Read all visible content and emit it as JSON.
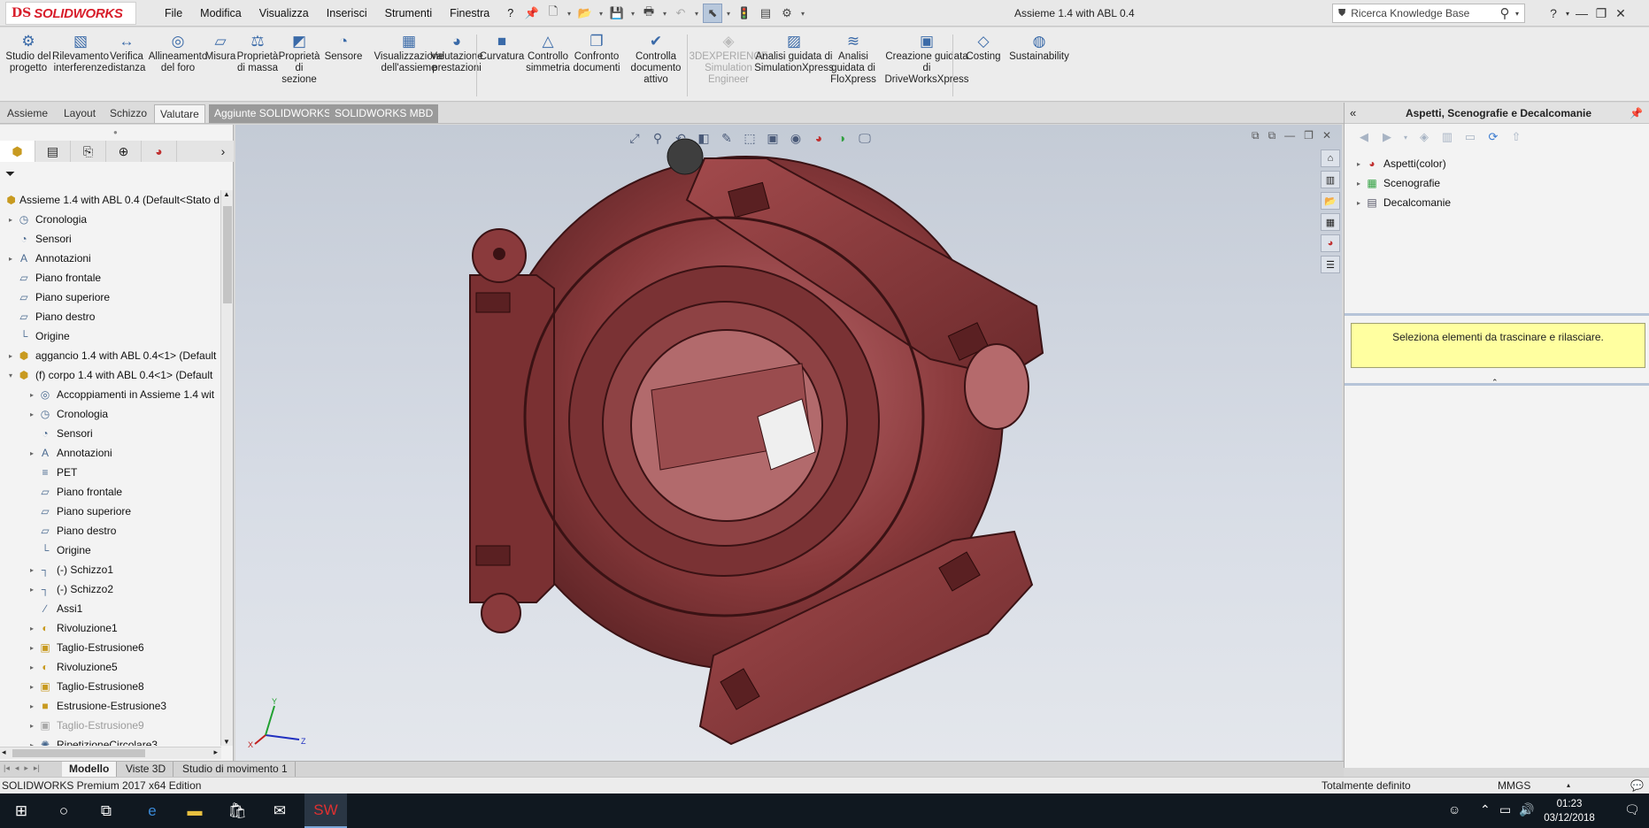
{
  "app": {
    "brand": "SOLIDWORKS",
    "brand_prefix": "DS",
    "document_title": "Assieme 1.4 with ABL 0.4",
    "search_placeholder": "Ricerca Knowledge Base",
    "help": "?"
  },
  "menu": [
    "File",
    "Modifica",
    "Visualizza",
    "Inserisci",
    "Strumenti",
    "Finestra",
    "?"
  ],
  "commands": [
    {
      "id": "studio-progetto",
      "label": "Studio del progetto",
      "icon": "design-study-icon",
      "glyph": "⚙",
      "disabled": false
    },
    {
      "id": "rilevamento-interferenze",
      "label": "Rilevamento interferenze",
      "icon": "interference-icon",
      "glyph": "▧",
      "disabled": false
    },
    {
      "id": "verifica-distanza",
      "label": "Verifica distanza",
      "icon": "clearance-icon",
      "glyph": "↔",
      "disabled": false
    },
    {
      "id": "allineamento-foro",
      "label": "Allineamento del foro",
      "icon": "hole-alignment-icon",
      "glyph": "◎",
      "disabled": false
    },
    {
      "id": "misura",
      "label": "Misura",
      "icon": "measure-icon",
      "glyph": "▱",
      "disabled": false
    },
    {
      "id": "proprieta-massa",
      "label": "Proprietà di massa",
      "icon": "mass-properties-icon",
      "glyph": "⚖",
      "disabled": false
    },
    {
      "id": "proprieta-sezione",
      "label": "Proprietà di sezione",
      "icon": "section-properties-icon",
      "glyph": "◩",
      "disabled": false
    },
    {
      "id": "sensore",
      "label": "Sensore",
      "icon": "sensor-icon",
      "glyph": "◔",
      "disabled": false
    },
    {
      "id": "visualizzazione-assieme",
      "label": "Visualizzazione dell'assieme",
      "icon": "assembly-visualization-icon",
      "glyph": "▦",
      "disabled": false
    },
    {
      "id": "valutazione-prestazioni",
      "label": "Valutazione prestazioni",
      "icon": "performance-icon",
      "glyph": "◕",
      "disabled": false
    },
    {
      "id": "curvatura",
      "label": "Curvatura",
      "icon": "curvature-icon",
      "glyph": "■",
      "disabled": false
    },
    {
      "id": "controllo-simmetria",
      "label": "Controllo simmetria",
      "icon": "symmetry-icon",
      "glyph": "△",
      "disabled": false
    },
    {
      "id": "confronto-documenti",
      "label": "Confronto documenti",
      "icon": "compare-documents-icon",
      "glyph": "❐",
      "disabled": false
    },
    {
      "id": "controlla-documento",
      "label": "Controlla documento attivo",
      "icon": "check-document-icon",
      "glyph": "✔",
      "disabled": false
    },
    {
      "id": "3dexperience",
      "label": "3DEXPERIENCE Simulation Engineer",
      "icon": "3dexperience-icon",
      "glyph": "◈",
      "disabled": true
    },
    {
      "id": "simulationxpress",
      "label": "Analisi guidata di SimulationXpress",
      "icon": "simulationxpress-icon",
      "glyph": "▨",
      "disabled": false
    },
    {
      "id": "floxpress",
      "label": "Analisi guidata di FloXpress",
      "icon": "floxpress-icon",
      "glyph": "≋",
      "disabled": false
    },
    {
      "id": "driveworksxpress",
      "label": "Creazione guidata di DriveWorksXpress",
      "icon": "driveworks-icon",
      "glyph": "▣",
      "disabled": false
    },
    {
      "id": "costing",
      "label": "Costing",
      "icon": "costing-icon",
      "glyph": "◇",
      "disabled": false
    },
    {
      "id": "sustainability",
      "label": "Sustainability",
      "icon": "sustainability-icon",
      "glyph": "◍",
      "disabled": false
    }
  ],
  "tabs": [
    "Assieme",
    "Layout",
    "Schizzo",
    "Valutare",
    "Aggiunte SOLIDWORKS",
    "SOLIDWORKS MBD"
  ],
  "active_tab": "Valutare",
  "tree": [
    {
      "label": "Assieme 1.4 with ABL 0.4  (Default<Stato d",
      "level": 0,
      "expander": "",
      "icon": "assembly-icon",
      "glyph": "⬢"
    },
    {
      "label": "Cronologia",
      "level": 1,
      "expander": "▸",
      "icon": "history-icon",
      "glyph": "◷"
    },
    {
      "label": "Sensori",
      "level": 1,
      "expander": "",
      "icon": "sensor-icon",
      "glyph": "◔"
    },
    {
      "label": "Annotazioni",
      "level": 1,
      "expander": "▸",
      "icon": "annotations-icon",
      "glyph": "A"
    },
    {
      "label": "Piano frontale",
      "level": 1,
      "expander": "",
      "icon": "plane-icon",
      "glyph": "▱"
    },
    {
      "label": "Piano superiore",
      "level": 1,
      "expander": "",
      "icon": "plane-icon",
      "glyph": "▱"
    },
    {
      "label": "Piano destro",
      "level": 1,
      "expander": "",
      "icon": "plane-icon",
      "glyph": "▱"
    },
    {
      "label": "Origine",
      "level": 1,
      "expander": "",
      "icon": "origin-icon",
      "glyph": "└"
    },
    {
      "label": "aggancio 1.4 with ABL 0.4<1> (Default",
      "level": 1,
      "expander": "▸",
      "icon": "part-icon",
      "glyph": "⬢"
    },
    {
      "label": "(f) corpo 1.4 with ABL 0.4<1> (Default",
      "level": 1,
      "expander": "▾",
      "icon": "part-icon",
      "glyph": "⬢"
    },
    {
      "label": "Accoppiamenti in Assieme 1.4 wit",
      "level": 2,
      "expander": "▸",
      "icon": "mates-icon",
      "glyph": "◎"
    },
    {
      "label": "Cronologia",
      "level": 2,
      "expander": "▸",
      "icon": "history-icon",
      "glyph": "◷"
    },
    {
      "label": "Sensori",
      "level": 2,
      "expander": "",
      "icon": "sensor-icon",
      "glyph": "◔"
    },
    {
      "label": "Annotazioni",
      "level": 2,
      "expander": "▸",
      "icon": "annotations-icon",
      "glyph": "A"
    },
    {
      "label": "PET",
      "level": 2,
      "expander": "",
      "icon": "material-icon",
      "glyph": "≡"
    },
    {
      "label": "Piano frontale",
      "level": 2,
      "expander": "",
      "icon": "plane-icon",
      "glyph": "▱"
    },
    {
      "label": "Piano superiore",
      "level": 2,
      "expander": "",
      "icon": "plane-icon",
      "glyph": "▱"
    },
    {
      "label": "Piano destro",
      "level": 2,
      "expander": "",
      "icon": "plane-icon",
      "glyph": "▱"
    },
    {
      "label": "Origine",
      "level": 2,
      "expander": "",
      "icon": "origin-icon",
      "glyph": "└"
    },
    {
      "label": "(-) Schizzo1",
      "level": 2,
      "expander": "▸",
      "icon": "sketch-icon",
      "glyph": "┐"
    },
    {
      "label": "(-) Schizzo2",
      "level": 2,
      "expander": "▸",
      "icon": "sketch-icon",
      "glyph": "┐"
    },
    {
      "label": "Assi1",
      "level": 2,
      "expander": "",
      "icon": "axis-icon",
      "glyph": "∕"
    },
    {
      "label": "Rivoluzione1",
      "level": 2,
      "expander": "▸",
      "icon": "revolve-icon",
      "glyph": "◐"
    },
    {
      "label": "Taglio-Estrusione6",
      "level": 2,
      "expander": "▸",
      "icon": "cut-extrude-icon",
      "glyph": "▣"
    },
    {
      "label": "Rivoluzione5",
      "level": 2,
      "expander": "▸",
      "icon": "revolve-icon",
      "glyph": "◐"
    },
    {
      "label": "Taglio-Estrusione8",
      "level": 2,
      "expander": "▸",
      "icon": "cut-extrude-icon",
      "glyph": "▣"
    },
    {
      "label": "Estrusione-Estrusione3",
      "level": 2,
      "expander": "▸",
      "icon": "extrude-icon",
      "glyph": "■"
    },
    {
      "label": "Taglio-Estrusione9",
      "level": 2,
      "expander": "▸",
      "icon": "cut-extrude-icon",
      "glyph": "▣",
      "suppressed": true
    },
    {
      "label": "RipetizioneCircolare3",
      "level": 2,
      "expander": "▸",
      "icon": "circular-pattern-icon",
      "glyph": "✺"
    }
  ],
  "right_panel": {
    "title": "Aspetti, Scenografie e Decalcomanie",
    "items": [
      {
        "label": "Aspetti(color)",
        "icon": "appearances-icon",
        "glyph": "◕"
      },
      {
        "label": "Scenografie",
        "icon": "scenes-icon",
        "glyph": "▦"
      },
      {
        "label": "Decalcomanie",
        "icon": "decals-icon",
        "glyph": "▤"
      }
    ],
    "message": "Seleziona elementi da trascinare e rilasciare."
  },
  "bottom_tabs": [
    "Modello",
    "Viste 3D",
    "Studio di movimento 1"
  ],
  "active_bottom_tab": "Modello",
  "status": {
    "edition": "SOLIDWORKS Premium 2017 x64 Edition",
    "definition": "Totalmente definito",
    "units": "MMGS"
  },
  "taskbar": {
    "time": "01:23",
    "date": "03/12/2018"
  },
  "colors": {
    "model_body": "#8a3a3c",
    "brand_red": "#d81e2b",
    "message_bg": "#ffffa0",
    "taskbar": "#101820"
  }
}
